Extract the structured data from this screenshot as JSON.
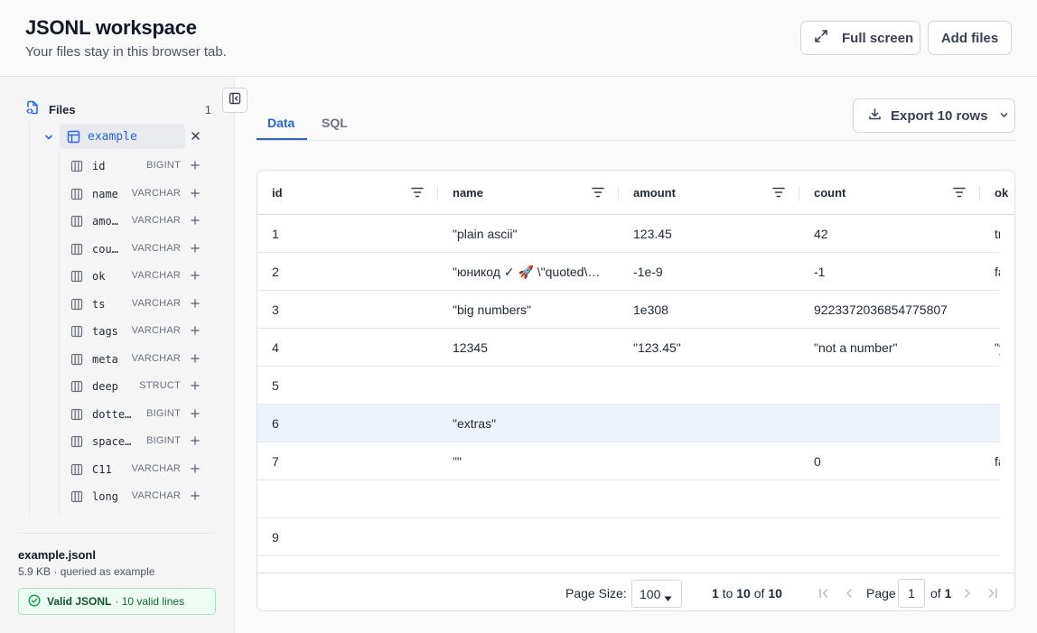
{
  "header": {
    "title": "JSONL workspace",
    "subtitle": "Your files stay in this browser tab.",
    "fullscreen_label": "Full screen",
    "add_files_label": "Add files"
  },
  "sidebar": {
    "files_title": "Files",
    "files_count": "1",
    "table_name": "example",
    "columns": [
      {
        "name": "id",
        "type": "BIGINT"
      },
      {
        "name": "name",
        "type": "VARCHAR"
      },
      {
        "name": "amount",
        "type": "VARCHAR"
      },
      {
        "name": "count",
        "type": "VARCHAR"
      },
      {
        "name": "ok",
        "type": "VARCHAR"
      },
      {
        "name": "ts",
        "type": "VARCHAR"
      },
      {
        "name": "tags",
        "type": "VARCHAR"
      },
      {
        "name": "meta",
        "type": "VARCHAR"
      },
      {
        "name": "deep",
        "type": "STRUCT"
      },
      {
        "name": "dotted.key",
        "type": "BIGINT"
      },
      {
        "name": "spaced key",
        "type": "BIGINT"
      },
      {
        "name": "C11",
        "type": "VARCHAR"
      },
      {
        "name": "long",
        "type": "VARCHAR"
      }
    ],
    "file_name": "example.jsonl",
    "file_meta": "5.9 KB · queried as example",
    "valid_label": "Valid JSONL",
    "valid_rest": "· 10 valid lines"
  },
  "tabs": [
    {
      "label": "Data",
      "active": true
    },
    {
      "label": "SQL",
      "active": false
    }
  ],
  "export_label": "Export 10 rows",
  "grid": {
    "headers": [
      "id",
      "name",
      "amount",
      "count",
      "ok"
    ],
    "rows": [
      [
        "1",
        "\"plain ascii\"",
        "123.45",
        "42",
        "true"
      ],
      [
        "2",
        "\"юникод ✓ 🚀 \\\"quoted\\\" text\"",
        "-1e-9",
        "-1",
        "false"
      ],
      [
        "3",
        "\"big numbers\"",
        "1e308",
        "9223372036854775807",
        ""
      ],
      [
        "4",
        "12345",
        "\"123.45\"",
        "\"not a number\"",
        "\"yes\""
      ],
      [
        "5",
        "",
        "",
        "",
        ""
      ],
      [
        "6",
        "\"extras\"",
        "",
        "",
        ""
      ],
      [
        "7",
        "\"\"",
        "",
        "0",
        "false"
      ],
      [
        "",
        "",
        "",
        "",
        ""
      ],
      [
        "9",
        "",
        "",
        "",
        ""
      ],
      [
        "",
        "",
        "",
        "",
        ""
      ]
    ],
    "selected_row": 5
  },
  "footer": {
    "page_size_label": "Page Size:",
    "page_size": "100",
    "range_from": "1",
    "range_to_word": "to",
    "range_to": "10",
    "of_word": "of",
    "total": "10",
    "page_label": "Page",
    "page_current": "1",
    "page_of_word": "of",
    "page_total": "1"
  },
  "colors": {
    "accent": "#2563eb",
    "valid_bg": "#ecfdf3",
    "valid_text": "#166534"
  },
  "icons": {
    "fullscreen": "expand-arrows-icon",
    "files": "file-code-icon",
    "table": "table-icon",
    "column": "column-icon",
    "export": "download-icon"
  }
}
